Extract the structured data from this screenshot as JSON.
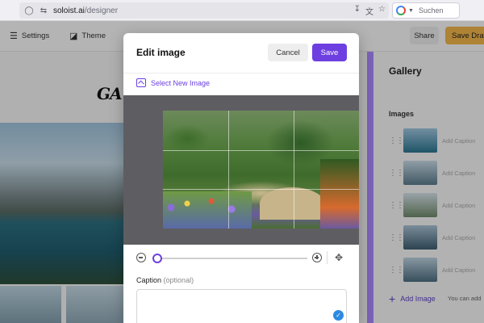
{
  "browser": {
    "url_host": "soloist.ai",
    "url_path": "/designer",
    "search_placeholder": "Suchen"
  },
  "toolbar": {
    "settings_label": "Settings",
    "theme_label": "Theme",
    "share_label": "Share",
    "save_draft_label": "Save Draft"
  },
  "canvas": {
    "logo_text": "GA"
  },
  "gallery_panel": {
    "title": "Gallery",
    "images_heading": "Images",
    "items": [
      {
        "caption_placeholder": "Add Caption"
      },
      {
        "caption_placeholder": "Add Caption"
      },
      {
        "caption_placeholder": "Add Caption"
      },
      {
        "caption_placeholder": "Add Caption"
      },
      {
        "caption_placeholder": "Add Caption"
      }
    ],
    "add_image_label": "Add Image",
    "add_note": "You can add"
  },
  "modal": {
    "title": "Edit image",
    "cancel_label": "Cancel",
    "save_label": "Save",
    "select_new_label": "Select New Image",
    "zoom_level": 0,
    "caption_label": "Caption",
    "caption_optional": "(optional)",
    "caption_value": ""
  },
  "colors": {
    "accent": "#6d3fe0",
    "save_draft": "#f2b64a"
  }
}
